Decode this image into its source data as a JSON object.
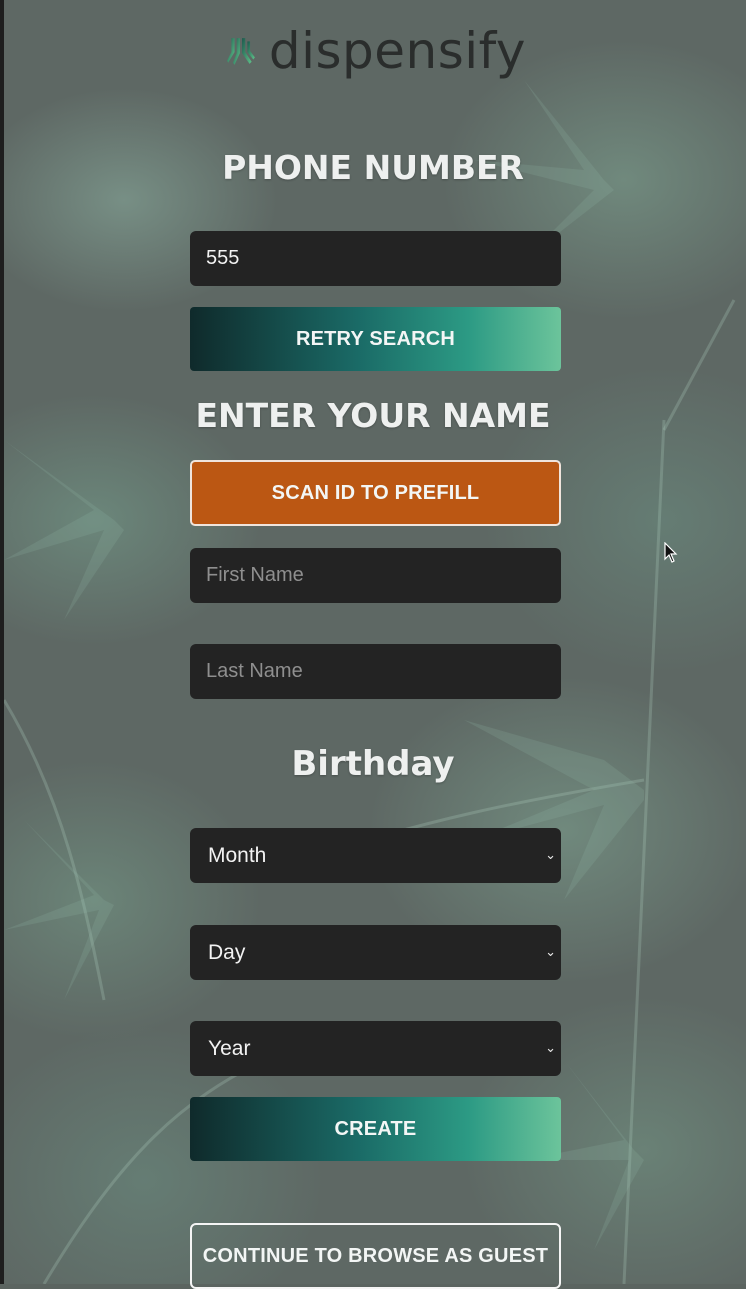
{
  "brand": {
    "name": "dispensify"
  },
  "phone": {
    "heading": "PHONE NUMBER",
    "input_value": "555",
    "retry_label": "RETRY SEARCH"
  },
  "name": {
    "heading": "ENTER YOUR NAME",
    "scan_label": "SCAN ID TO PREFILL",
    "first_placeholder": "First Name",
    "last_placeholder": "Last Name"
  },
  "birthday": {
    "heading": "Birthday",
    "month_value": "Month",
    "day_value": "Day",
    "year_value": "Year"
  },
  "actions": {
    "create_label": "CREATE",
    "guest_label": "CONTINUE TO BROWSE AS GUEST"
  },
  "icons": {
    "logo": "dispensify-leaf-logo",
    "select_chevron": "chevron-down-icon",
    "cursor": "mouse-pointer-icon"
  },
  "colors": {
    "accent_green": "#2c9a84",
    "scan_orange": "#bb5713",
    "field_bg": "#232323"
  }
}
